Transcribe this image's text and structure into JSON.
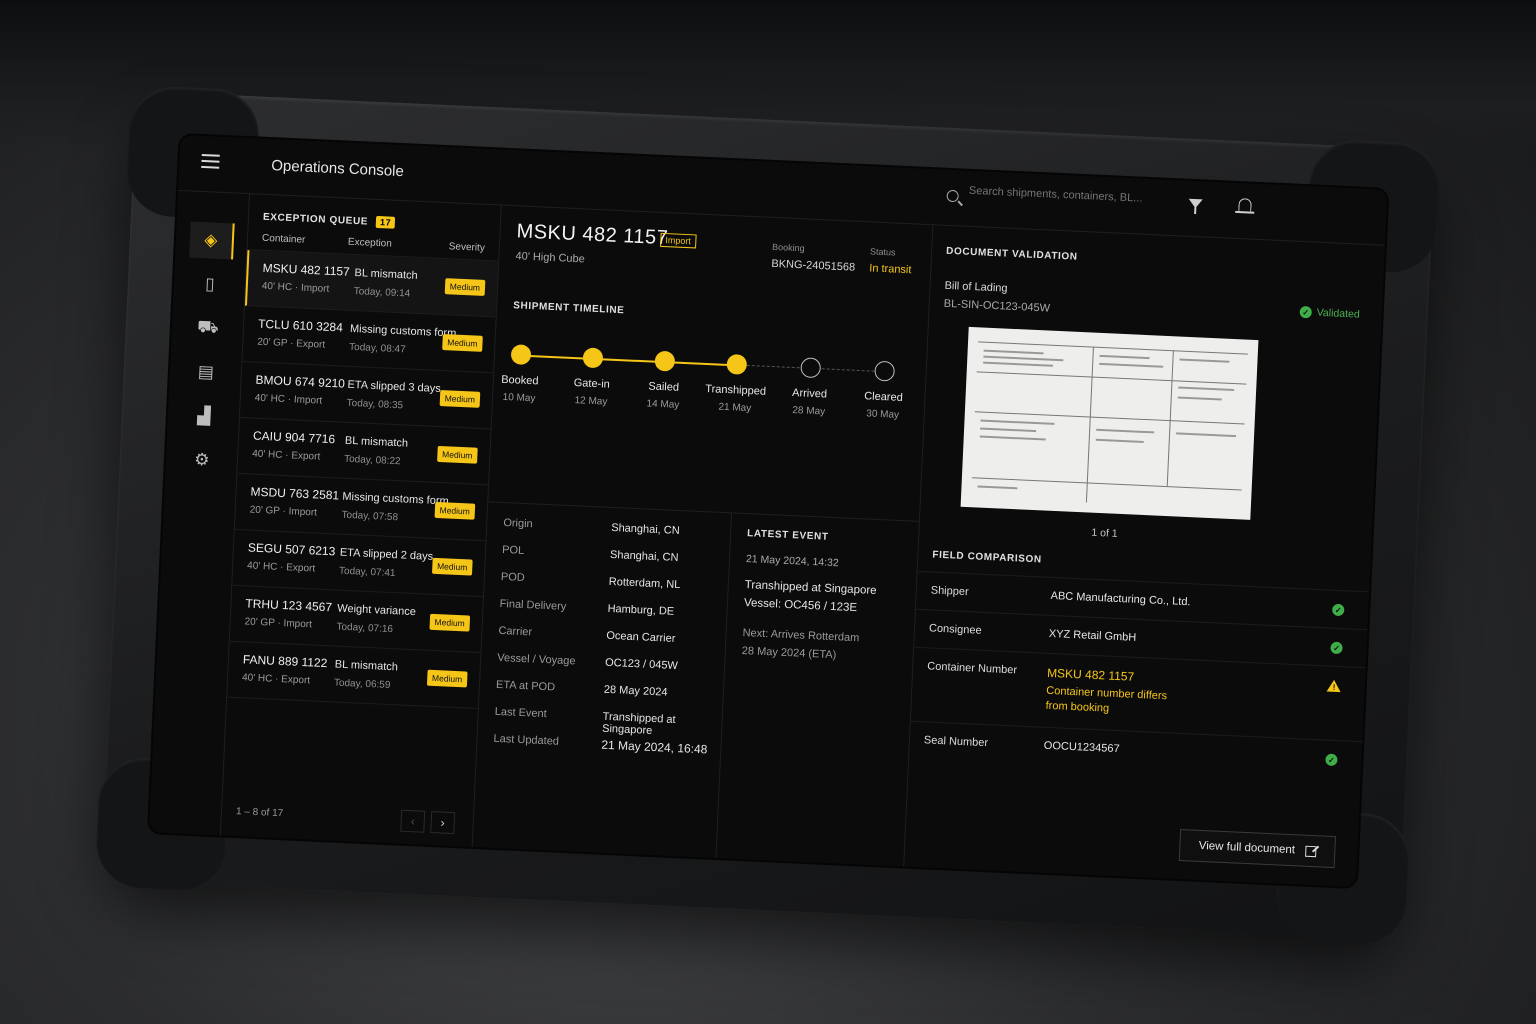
{
  "app": {
    "title": "Operations Console"
  },
  "search": {
    "placeholder": "Search shipments, containers, BL..."
  },
  "rail": {
    "items": [
      "layers-icon",
      "clipboard-icon",
      "truck-icon",
      "document-icon",
      "analytics-icon",
      "gear-icon"
    ]
  },
  "queue": {
    "title": "EXCEPTION QUEUE",
    "count": "17",
    "columns": [
      "Container",
      "Exception",
      "Severity"
    ],
    "rows": [
      {
        "container": "MSKU 482 1157",
        "type": "40' HC · Import",
        "exception": "BL mismatch",
        "time": "Today, 09:14",
        "severity": "Medium"
      },
      {
        "container": "TCLU 610 3284",
        "type": "20' GP · Export",
        "exception": "Missing customs form",
        "time": "Today, 08:47",
        "severity": "Medium"
      },
      {
        "container": "BMOU 674 9210",
        "type": "40' HC · Import",
        "exception": "ETA slipped 3 days",
        "time": "Today, 08:35",
        "severity": "Medium"
      },
      {
        "container": "CAIU 904 7716",
        "type": "40' HC · Export",
        "exception": "BL mismatch",
        "time": "Today, 08:22",
        "severity": "Medium"
      },
      {
        "container": "MSDU 763 2581",
        "type": "20' GP · Import",
        "exception": "Missing customs form",
        "time": "Today, 07:58",
        "severity": "Medium"
      },
      {
        "container": "SEGU 507 6213",
        "type": "40' HC · Export",
        "exception": "ETA slipped 2 days",
        "time": "Today, 07:41",
        "severity": "Medium"
      },
      {
        "container": "TRHU 123 4567",
        "type": "20' GP · Import",
        "exception": "Weight variance",
        "time": "Today, 07:16",
        "severity": "Medium"
      },
      {
        "container": "FANU 889 1122",
        "type": "40' HC · Export",
        "exception": "BL mismatch",
        "time": "Today, 06:59",
        "severity": "Medium"
      }
    ],
    "pager": {
      "label": "1 – 8 of 17",
      "prev": "‹",
      "next": "›"
    }
  },
  "detail": {
    "container": "MSKU 482 1157",
    "tag": "Import",
    "subtitle": "40' High Cube",
    "booking_label": "Booking",
    "booking": "BKNG-24051568",
    "status_label": "Status",
    "status": "In transit",
    "timeline_title": "SHIPMENT TIMELINE",
    "timeline": [
      {
        "label": "Booked",
        "date": "10 May",
        "done": true
      },
      {
        "label": "Gate-in",
        "date": "12 May",
        "done": true
      },
      {
        "label": "Sailed",
        "date": "14 May",
        "done": true
      },
      {
        "label": "Transhipped",
        "date": "21 May",
        "done": true
      },
      {
        "label": "Arrived",
        "date": "28 May",
        "done": false
      },
      {
        "label": "Cleared",
        "date": "30 May",
        "done": false
      }
    ],
    "info": [
      {
        "k": "Origin",
        "v": "Shanghai, CN"
      },
      {
        "k": "POL",
        "v": "Shanghai, CN"
      },
      {
        "k": "POD",
        "v": "Rotterdam, NL"
      },
      {
        "k": "Final Delivery",
        "v": "Hamburg, DE"
      },
      {
        "k": "Carrier",
        "v": "Ocean Carrier"
      },
      {
        "k": "Vessel / Voyage",
        "v": "OC123 / 045W"
      },
      {
        "k": "ETA at POD",
        "v": "28 May 2024"
      },
      {
        "k": "Last Event",
        "v": "Transhipped at Singapore"
      },
      {
        "k": "Last Updated",
        "v": "21 May 2024, 16:48"
      }
    ],
    "latest": {
      "title": "LATEST EVENT",
      "time": "21 May 2024, 14:32",
      "event": "Transhipped at Singapore",
      "vessel": "Vessel: OC456 / 123E",
      "next": "Next: Arrives Rotterdam",
      "next_eta": "28 May 2024 (ETA)"
    }
  },
  "docs": {
    "title": "DOCUMENT VALIDATION",
    "doc_label": "Bill of Lading",
    "doc_id": "BL-SIN-OC123-045W",
    "status": "Validated",
    "page": "1 of 1",
    "compare_title": "FIELD COMPARISON",
    "fields": [
      {
        "k": "Shipper",
        "v": "ABC Manufacturing Co., Ltd.",
        "state": "ok"
      },
      {
        "k": "Consignee",
        "v": "XYZ Retail GmbH",
        "state": "ok"
      },
      {
        "k": "Container Number",
        "v": "MSKU 482 1157",
        "note": "Container number differs from booking",
        "state": "warn"
      },
      {
        "k": "Seal Number",
        "v": "OOCU1234567",
        "state": "ok"
      }
    ],
    "view_button": "View full document"
  },
  "colors": {
    "accent": "#f5c518",
    "ok": "#3fae49",
    "background": "#0b0b0c"
  }
}
